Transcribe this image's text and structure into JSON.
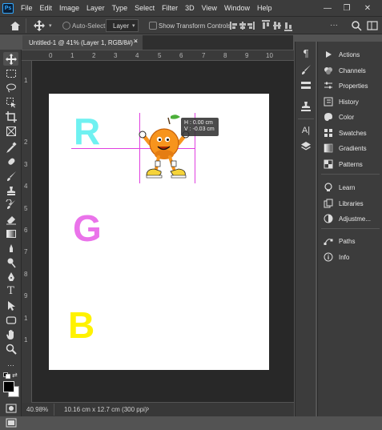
{
  "app": {
    "logo": "Ps"
  },
  "menu": [
    "File",
    "Edit",
    "Image",
    "Layer",
    "Type",
    "Select",
    "Filter",
    "3D",
    "View",
    "Window",
    "Help"
  ],
  "window_controls": {
    "minimize": "—",
    "maximize": "❐",
    "close": "✕"
  },
  "options": {
    "auto_select_label": "Auto-Select:",
    "auto_select_target": "Layer",
    "show_transform_label": "Show Transform Controls",
    "more": "···"
  },
  "document": {
    "tab_title": "Untitled-1 @ 41% (Layer 1, RGB/8#) *",
    "close": "✕"
  },
  "ruler": {
    "top": [
      "0",
      "1",
      "2",
      "3",
      "4",
      "5",
      "6",
      "7",
      "8",
      "9",
      "10"
    ],
    "left": [
      "1",
      "2",
      "3",
      "4",
      "5",
      "6",
      "7",
      "8",
      "9",
      "1",
      "1"
    ]
  },
  "canvas": {
    "letters": [
      {
        "text": "R",
        "color": "#6ff1f1"
      },
      {
        "text": "G",
        "color": "#ea73ea"
      },
      {
        "text": "B",
        "color": "#fff200"
      }
    ],
    "tooltip": {
      "h": "H : 0.00 cm",
      "v": "V : -0.03 cm"
    }
  },
  "status": {
    "zoom": "40.98%",
    "doc_info": "10.16 cm x 12.7 cm (300 ppi)",
    "arrow": "›"
  },
  "panels": [
    {
      "label": "Actions",
      "icon": "actions-icon"
    },
    {
      "label": "Channels",
      "icon": "channels-icon"
    },
    {
      "label": "Properties",
      "icon": "properties-icon"
    },
    {
      "label": "History",
      "icon": "history-icon"
    },
    {
      "label": "Color",
      "icon": "color-icon"
    },
    {
      "label": "Swatches",
      "icon": "swatches-icon"
    },
    {
      "label": "Gradients",
      "icon": "gradients-icon"
    },
    {
      "label": "Patterns",
      "icon": "patterns-icon"
    },
    {
      "label": "Learn",
      "icon": "learn-icon"
    },
    {
      "label": "Libraries",
      "icon": "libraries-icon"
    },
    {
      "label": "Adjustme...",
      "icon": "adjustments-icon"
    },
    {
      "label": "Paths",
      "icon": "paths-icon"
    },
    {
      "label": "Info",
      "icon": "info-icon"
    }
  ],
  "colors": {
    "accent": "#31a8ff",
    "guide": "#e040e0"
  }
}
